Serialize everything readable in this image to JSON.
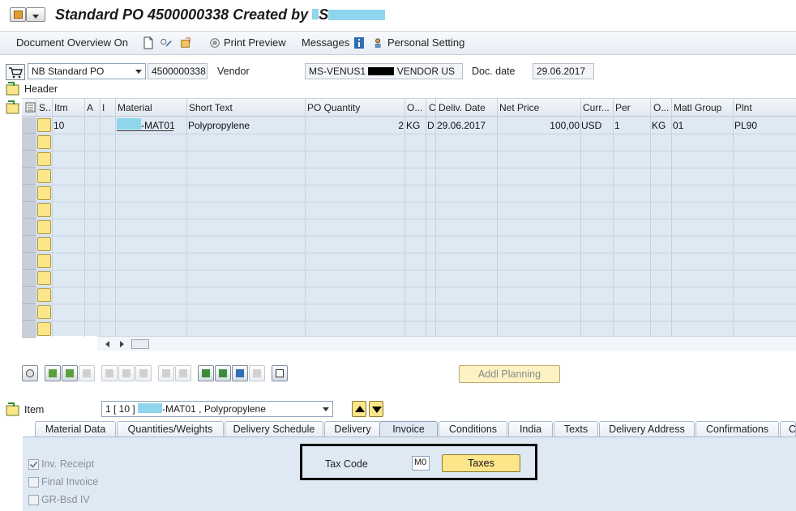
{
  "window": {
    "title": "Standard PO 4500000338 Created by",
    "title_suffix": "S"
  },
  "toolbar": {
    "doc_overview": "Document Overview On",
    "print_preview": "Print Preview",
    "messages": "Messages",
    "personal_setting": "Personal Setting"
  },
  "header": {
    "po_type": "NB Standard PO",
    "po_number": "4500000338",
    "vendor_label": "Vendor",
    "vendor_value_prefix": "MS-VENUS1",
    "vendor_value_suffix": "VENDOR US",
    "doc_date_label": "Doc. date",
    "doc_date": "29.06.2017",
    "header_label": "Header"
  },
  "grid": {
    "columns": [
      "S..",
      "Itm",
      "A",
      "I",
      "Material",
      "Short Text",
      "PO Quantity",
      "O...",
      "C",
      "Deliv. Date",
      "Net Price",
      "Curr...",
      "Per",
      "O...",
      "Matl Group",
      "Plnt"
    ],
    "row1": {
      "item": "10",
      "material": "-MAT01",
      "short_text": "Polypropylene",
      "quantity": "2",
      "unit": "KG",
      "c": "D",
      "deliv_date": "29.06.2017",
      "net_price": "100,00",
      "currency": "USD",
      "per": "1",
      "order_unit": "KG",
      "matl_group": "01",
      "plant": "PL90"
    }
  },
  "buttons": {
    "addl_planning": "Addl Planning"
  },
  "item_section": {
    "label": "Item",
    "selected_prefix": "1 [ 10 ]",
    "selected_suffix": "-MAT01 , Polypropylene"
  },
  "tabs": {
    "material_data": "Material Data",
    "quantities_weights": "Quantities/Weights",
    "delivery_schedule": "Delivery Schedule",
    "delivery": "Delivery",
    "invoice": "Invoice",
    "conditions": "Conditions",
    "india": "India",
    "texts": "Texts",
    "delivery_address": "Delivery Address",
    "confirmations": "Confirmations",
    "more": "Co"
  },
  "invoice_tab": {
    "inv_receipt": "Inv. Receipt",
    "final_invoice": "Final Invoice",
    "gr_bsd_iv": "GR-Bsd IV",
    "tax_code_label": "Tax Code",
    "tax_code_value": "M0",
    "taxes_button": "Taxes"
  },
  "colors": {
    "accent_yellow": "#fde58a",
    "panel_blue": "#dfe9f4",
    "mask": "#8fd6ec"
  }
}
